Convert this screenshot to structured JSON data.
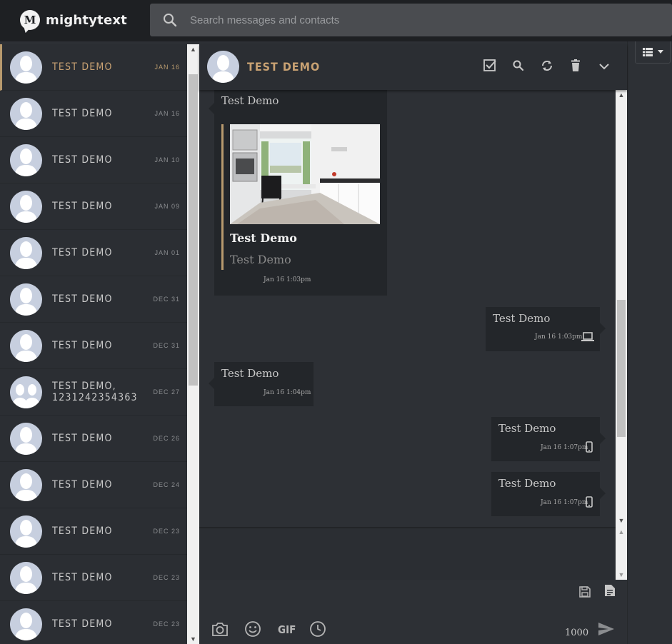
{
  "app": {
    "logo_letter": "M",
    "logo_text": "mightytext"
  },
  "search": {
    "placeholder": "Search messages and contacts"
  },
  "sidebar": {
    "conversations": [
      {
        "name": "TEST DEMO",
        "date": "JAN 16",
        "active": true
      },
      {
        "name": "TEST DEMO",
        "date": "JAN 16"
      },
      {
        "name": "TEST DEMO",
        "date": "JAN 10"
      },
      {
        "name": "TEST DEMO",
        "date": "JAN 09"
      },
      {
        "name": "TEST DEMO",
        "date": "JAN 01"
      },
      {
        "name": "TEST DEMO",
        "date": "DEC 31"
      },
      {
        "name": "TEST DEMO",
        "date": "DEC 31"
      },
      {
        "name": "TEST DEMO, 1231242354363",
        "date": "DEC 27",
        "group": true
      },
      {
        "name": "TEST DEMO",
        "date": "DEC 26"
      },
      {
        "name": "TEST DEMO",
        "date": "DEC 24"
      },
      {
        "name": "TEST DEMO",
        "date": "DEC 23"
      },
      {
        "name": "TEST DEMO",
        "date": "DEC 23"
      },
      {
        "name": "TEST DEMO",
        "date": "DEC 23"
      }
    ]
  },
  "conversation": {
    "title": "TEST DEMO",
    "header_icons": [
      "select-checkbox-icon",
      "search-icon",
      "refresh-icon",
      "trash-icon",
      "chevron-down-icon"
    ],
    "messages": [
      {
        "direction": "in",
        "text": "Test Demo",
        "card_title": "Test Demo",
        "card_subtitle": "Test Demo",
        "time": "Jan 16 1:03pm"
      },
      {
        "direction": "out",
        "text": "Test Demo",
        "time": "Jan 16 1:03pm",
        "source_icon": "laptop-icon"
      },
      {
        "direction": "in",
        "text": "Test Demo",
        "time": "Jan 16 1:04pm"
      },
      {
        "direction": "out",
        "text": "Test Demo",
        "time": "Jan 16 1:07pm",
        "source_icon": "phone-icon"
      },
      {
        "direction": "out",
        "text": "Test Demo",
        "time": "Jan 16 1:07pm",
        "source_icon": "phone-icon"
      }
    ]
  },
  "compose": {
    "char_count": "1000",
    "gif_label": "GIF",
    "icons": [
      "camera-icon",
      "emoji-icon",
      "gif-icon",
      "schedule-clock-icon",
      "save-draft-icon",
      "template-icon",
      "send-icon"
    ]
  },
  "colors": {
    "accent": "#c9a273",
    "bubble": "#23262a",
    "background": "#2d3035",
    "sidebar": "#2b2e33",
    "topbar": "#1e2023"
  }
}
